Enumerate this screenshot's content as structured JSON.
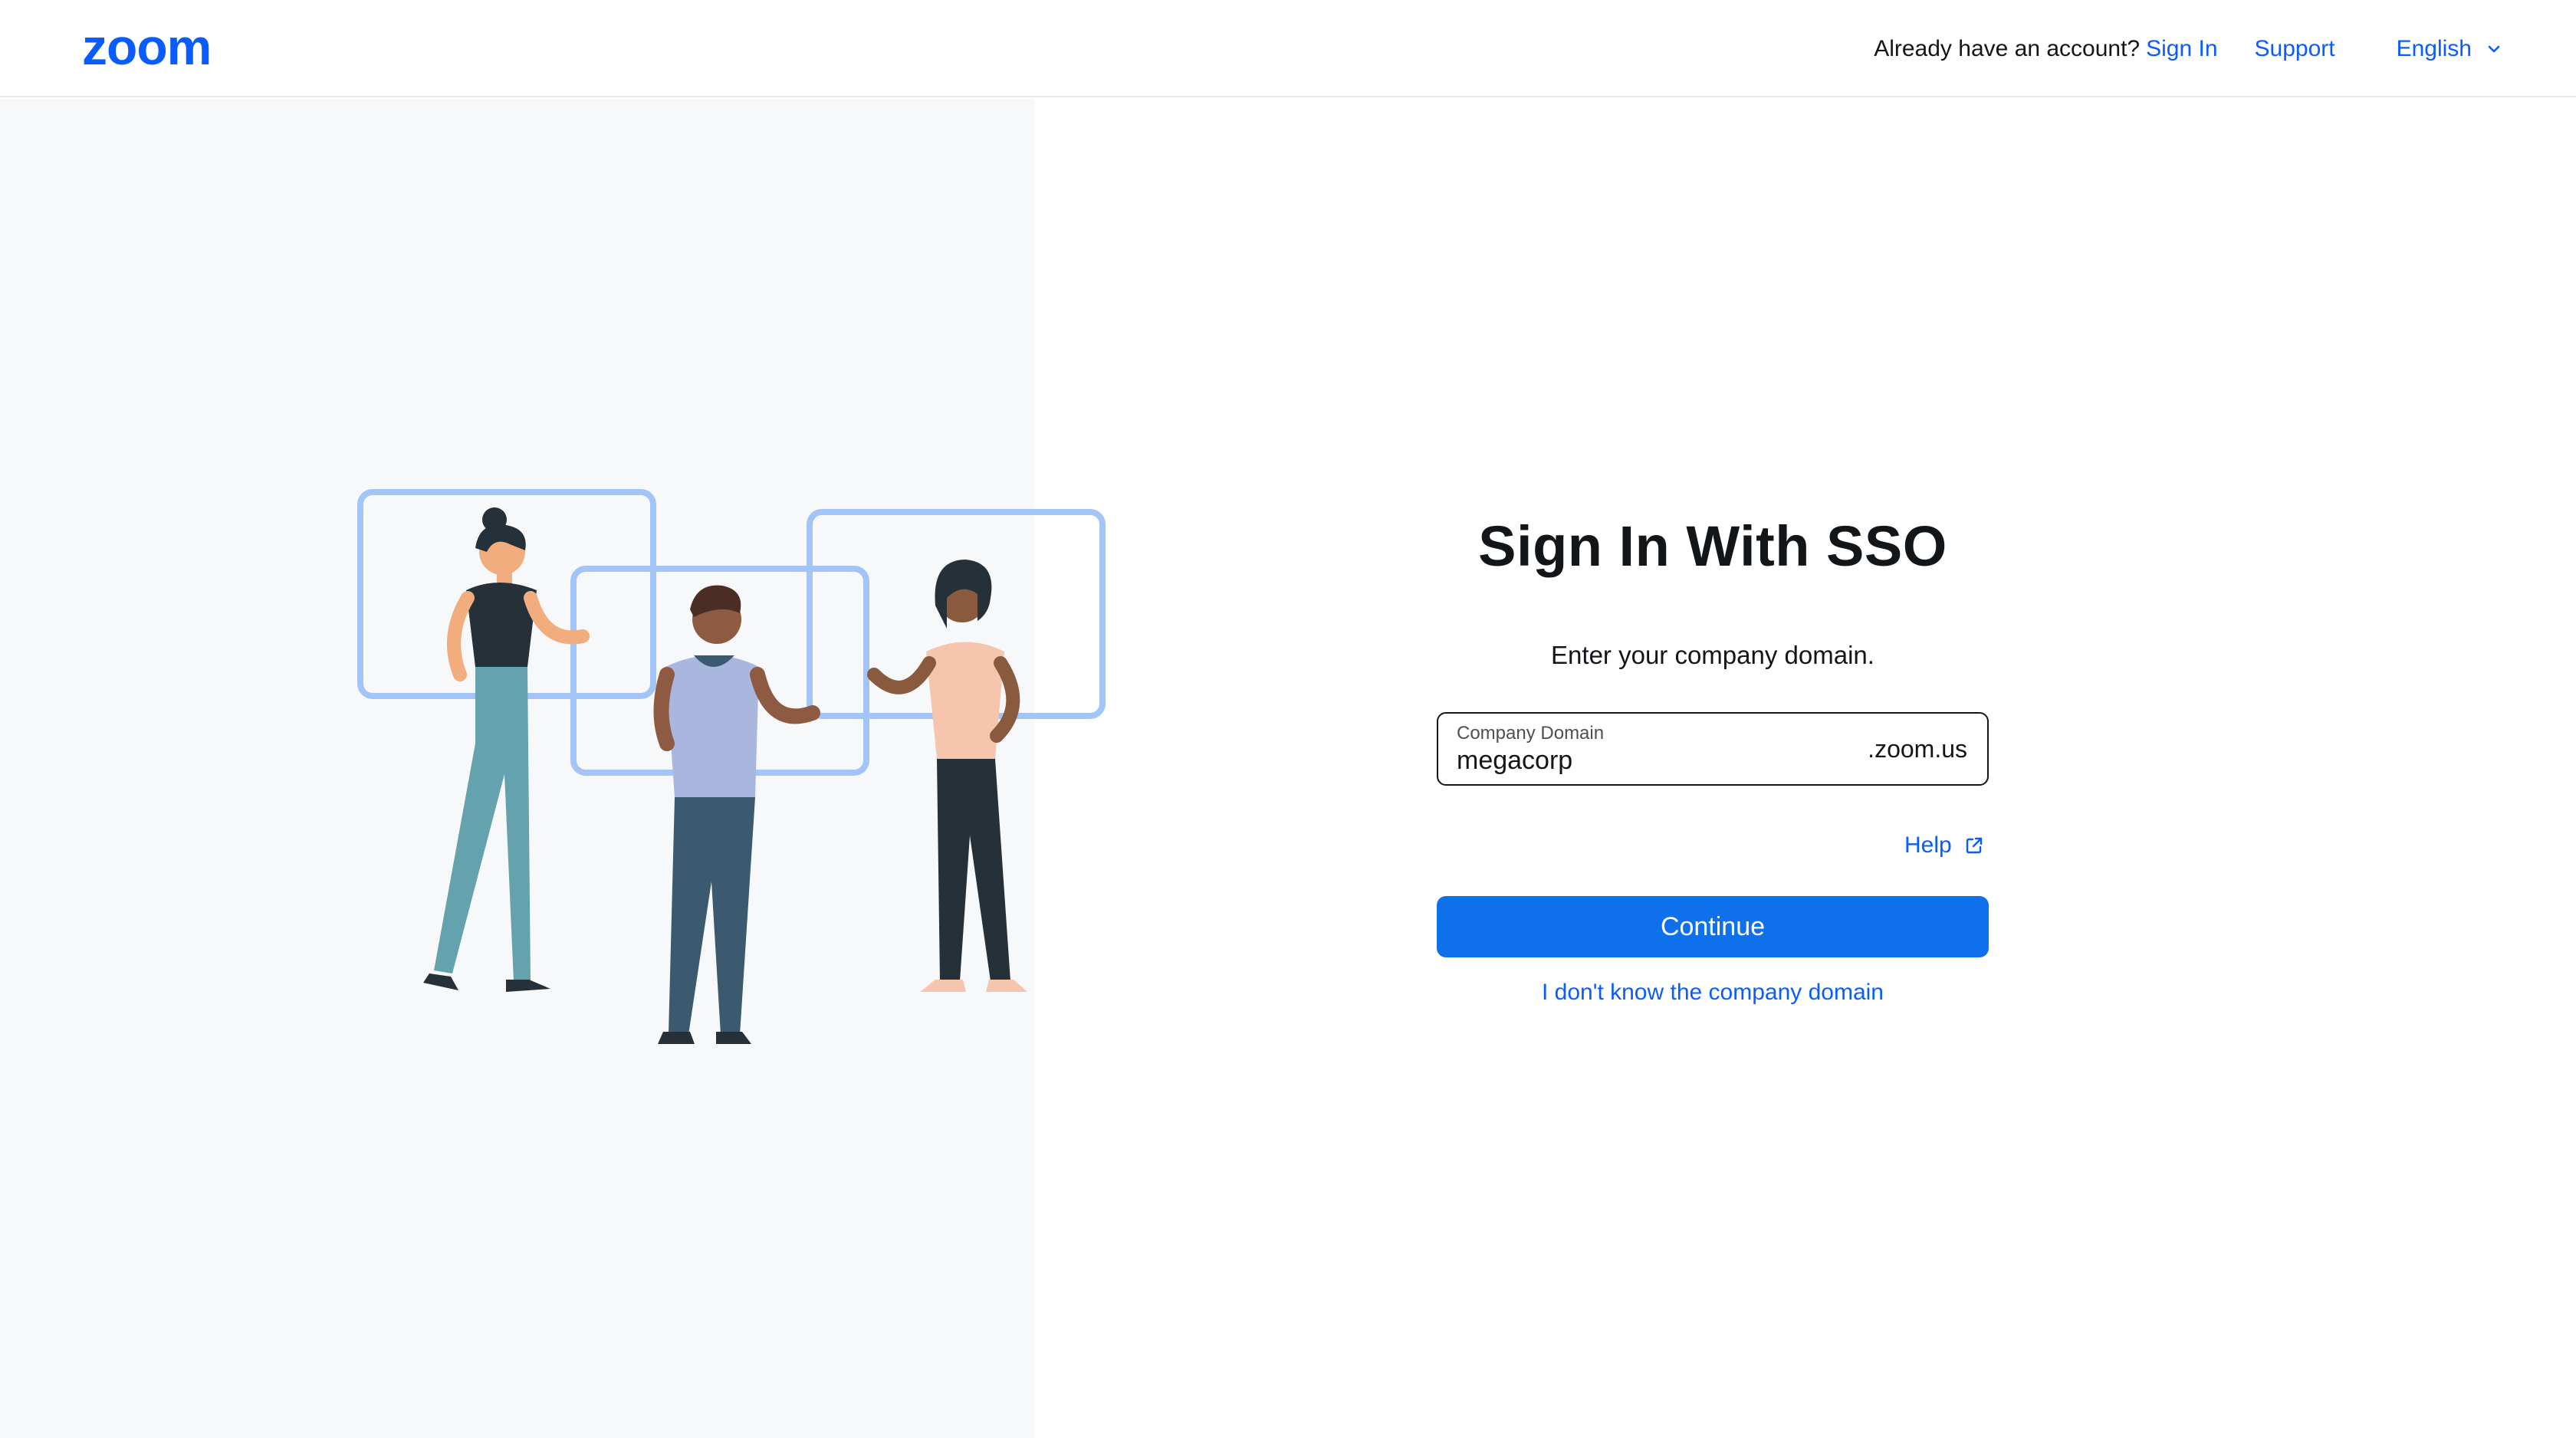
{
  "header": {
    "logo_text": "zoom",
    "account_prompt": "Already have an account?",
    "sign_in_link": "Sign In",
    "support_link": "Support",
    "language": "English",
    "language_icon": "chevron-down-icon"
  },
  "main": {
    "title": "Sign In With SSO",
    "subtitle": "Enter your company domain.",
    "domain_field": {
      "label": "Company Domain",
      "value": "megacorp",
      "suffix": ".zoom.us"
    },
    "help_link": "Help",
    "help_icon": "external-link-icon",
    "continue_button": "Continue",
    "unknown_domain_link": "I don't know the company domain"
  },
  "colors": {
    "brand": "#0b5cff",
    "button": "#0e71eb",
    "left_panel_bg": "#f7f8f9",
    "frame_stroke": "#a3c4f7"
  }
}
